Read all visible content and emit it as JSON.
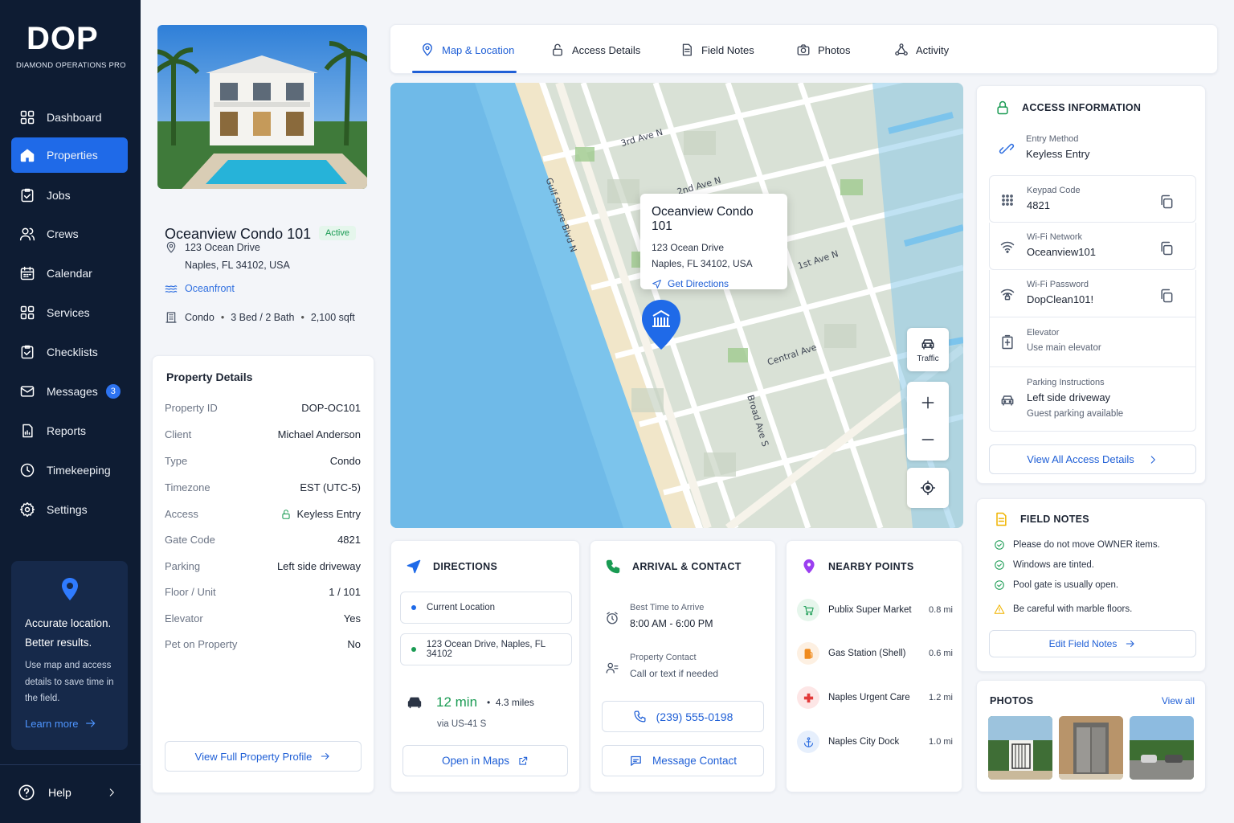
{
  "brand": {
    "logo": "DOP",
    "subtitle": "DIAMOND OPERATIONS PRO"
  },
  "nav": [
    {
      "label": "Dashboard",
      "icon": "grid-icon"
    },
    {
      "label": "Properties",
      "icon": "home-icon",
      "active": true
    },
    {
      "label": "Jobs",
      "icon": "clipboard-icon"
    },
    {
      "label": "Crews",
      "icon": "users-icon"
    },
    {
      "label": "Calendar",
      "icon": "calendar-icon"
    },
    {
      "label": "Services",
      "icon": "grid-icon"
    },
    {
      "label": "Checklists",
      "icon": "checklist-icon"
    },
    {
      "label": "Messages",
      "icon": "mail-icon",
      "badge": "3"
    },
    {
      "label": "Reports",
      "icon": "report-icon"
    },
    {
      "label": "Timekeeping",
      "icon": "clock-icon"
    },
    {
      "label": "Settings",
      "icon": "gear-icon"
    }
  ],
  "promo": {
    "title": "Accurate location. Better results.",
    "text": "Use map and access details to save time in the field.",
    "link": "Learn more"
  },
  "help": {
    "label": "Help"
  },
  "property": {
    "name": "Oceanview Condo 101",
    "status": "Active",
    "address_line1": "123 Ocean Drive",
    "address_line2": "Naples, FL 34102, USA",
    "tag": "Oceanfront",
    "type": "Condo",
    "beds_baths": "3 Bed / 2 Bath",
    "sqft": "2,100 sqft"
  },
  "details": {
    "title": "Property Details",
    "rows": [
      {
        "k": "Property ID",
        "v": "DOP-OC101"
      },
      {
        "k": "Client",
        "v": "Michael Anderson"
      },
      {
        "k": "Type",
        "v": "Condo"
      },
      {
        "k": "Timezone",
        "v": "EST (UTC-5)"
      },
      {
        "k": "Access",
        "v": "Keyless Entry"
      },
      {
        "k": "Gate Code",
        "v": "4821"
      },
      {
        "k": "Parking",
        "v": "Left side driveway"
      },
      {
        "k": "Floor / Unit",
        "v": "1 / 101"
      },
      {
        "k": "Elevator",
        "v": "Yes"
      },
      {
        "k": "Pet on Property",
        "v": "No"
      }
    ],
    "button": "View Full Property Profile"
  },
  "tabs": [
    {
      "label": "Map & Location",
      "icon": "map-pin-icon",
      "active": true
    },
    {
      "label": "Access Details",
      "icon": "lock-icon"
    },
    {
      "label": "Field Notes",
      "icon": "notes-icon"
    },
    {
      "label": "Photos",
      "icon": "camera-icon"
    },
    {
      "label": "Activity",
      "icon": "activity-icon"
    }
  ],
  "map": {
    "popup": {
      "title": "Oceanview Condo 101",
      "line1": "123 Ocean Drive",
      "line2": "Naples, FL 34102, USA",
      "link": "Get Directions"
    },
    "roads": [
      "3rd Ave N",
      "2nd Ave N",
      "1st Ave N",
      "Central Ave",
      "Gulf Shore Blvd N",
      "Broad Ave S"
    ],
    "traffic_label": "Traffic"
  },
  "directions": {
    "title": "DIRECTIONS",
    "from": "Current Location",
    "to": "123 Ocean Drive, Naples, FL 34102",
    "eta": "12 min",
    "distance": "4.3 miles",
    "via": "via US-41 S",
    "button": "Open in Maps"
  },
  "arrival": {
    "title": "ARRIVAL & CONTACT",
    "best_time_label": "Best Time to Arrive",
    "best_time": "8:00 AM - 6:00 PM",
    "contact_label": "Property Contact",
    "contact_note": "Call or text if needed",
    "phone": "(239) 555-0198",
    "message_button": "Message Contact"
  },
  "nearby": {
    "title": "NEARBY POINTS",
    "items": [
      {
        "name": "Publix Super Market",
        "dist": "0.8 mi",
        "icon": "cart-icon",
        "color": "#22a05a"
      },
      {
        "name": "Gas Station (Shell)",
        "dist": "0.6 mi",
        "icon": "fuel-icon",
        "color": "#f08a1c"
      },
      {
        "name": "Naples Urgent Care",
        "dist": "1.2 mi",
        "icon": "medical-cross-icon",
        "color": "#e23a3a"
      },
      {
        "name": "Naples City Dock",
        "dist": "1.0 mi",
        "icon": "anchor-icon",
        "color": "#2f6fe0"
      }
    ]
  },
  "access": {
    "title": "ACCESS INFORMATION",
    "entry_label": "Entry Method",
    "entry": "Keyless Entry",
    "keypad_label": "Keypad Code",
    "keypad": "4821",
    "wifi_label": "Wi-Fi Network",
    "wifi": "Oceanview101",
    "wifi_pw_label": "Wi-Fi Password",
    "wifi_pw": "DopClean101!",
    "elevator_label": "Elevator",
    "elevator": "Use main elevator",
    "parking_label": "Parking Instructions",
    "parking": "Left side driveway",
    "parking_note": "Guest parking available",
    "button": "View All Access Details"
  },
  "notes": {
    "title": "FIELD NOTES",
    "items": [
      {
        "text": "Please do not move OWNER items.",
        "kind": "check"
      },
      {
        "text": "Windows are tinted.",
        "kind": "check"
      },
      {
        "text": "Pool gate is usually open.",
        "kind": "check"
      },
      {
        "text": "Be careful with marble floors.",
        "kind": "warning"
      }
    ],
    "button": "Edit Field Notes"
  },
  "photos": {
    "title": "PHOTOS",
    "view_all": "View all"
  },
  "colors": {
    "sidebar": "#0e1c33",
    "accent": "#1f6ae8",
    "success": "#1a9b53",
    "warning": "#f0b400"
  }
}
